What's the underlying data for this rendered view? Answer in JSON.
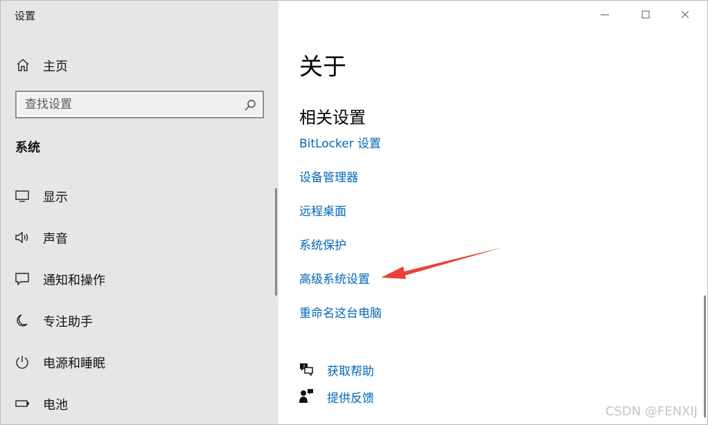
{
  "window": {
    "title": "设置"
  },
  "sidebar": {
    "home_label": "主页",
    "search_placeholder": "查找设置",
    "section_header": "系统",
    "items": [
      {
        "label": "显示",
        "icon": "display-icon"
      },
      {
        "label": "声音",
        "icon": "speaker-icon"
      },
      {
        "label": "通知和操作",
        "icon": "notification-icon"
      },
      {
        "label": "专注助手",
        "icon": "moon-icon"
      },
      {
        "label": "电源和睡眠",
        "icon": "power-icon"
      },
      {
        "label": "电池",
        "icon": "battery-icon"
      }
    ]
  },
  "main": {
    "title": "关于",
    "related_heading": "相关设置",
    "links": [
      "BitLocker 设置",
      "设备管理器",
      "远程桌面",
      "系统保护",
      "高级系统设置",
      "重命名这台电脑"
    ],
    "help": [
      {
        "label": "获取帮助",
        "icon": "help-chat-icon"
      },
      {
        "label": "提供反馈",
        "icon": "feedback-icon"
      }
    ]
  },
  "colors": {
    "link": "#0067b8",
    "sidebar_bg": "#e6e6e6",
    "annotation_arrow": "#e8403a"
  },
  "watermark": "CSDN @FENXIJ"
}
